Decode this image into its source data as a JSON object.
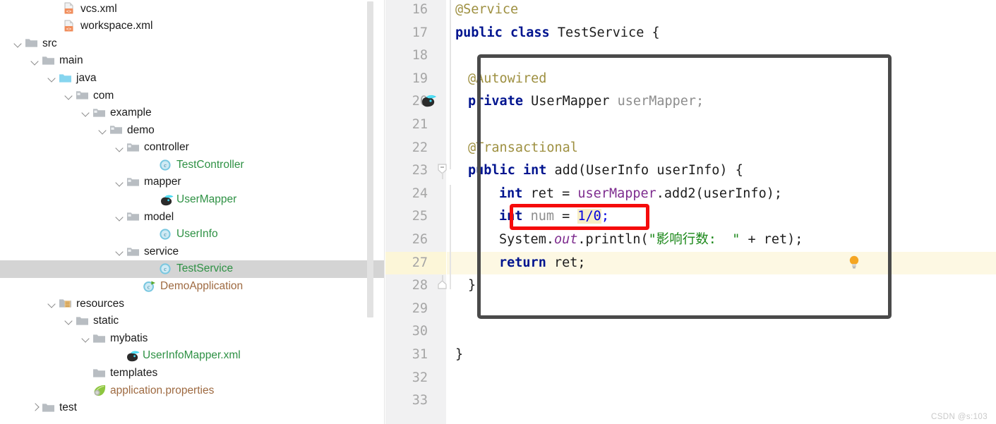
{
  "sidebar": {
    "name": "project-tree",
    "scrollbar": {
      "name": "vertical-scrollbar"
    },
    "items": [
      {
        "label": "vcs.xml",
        "indent": 72,
        "arrow": "none",
        "icon": "xml-file-icon",
        "color": "plain"
      },
      {
        "label": "workspace.xml",
        "indent": 72,
        "arrow": "none",
        "icon": "xml-file-icon",
        "color": "plain"
      },
      {
        "label": "src",
        "indent": 18,
        "arrow": "down",
        "icon": "folder-icon",
        "color": "plain"
      },
      {
        "label": "main",
        "indent": 42,
        "arrow": "down",
        "icon": "folder-icon",
        "color": "plain"
      },
      {
        "label": "java",
        "indent": 66,
        "arrow": "down",
        "icon": "source-folder-icon",
        "color": "plain"
      },
      {
        "label": "com",
        "indent": 90,
        "arrow": "down",
        "icon": "package-folder-icon",
        "color": "plain"
      },
      {
        "label": "example",
        "indent": 114,
        "arrow": "down",
        "icon": "package-folder-icon",
        "color": "plain"
      },
      {
        "label": "demo",
        "indent": 138,
        "arrow": "down",
        "icon": "package-folder-icon",
        "color": "plain"
      },
      {
        "label": "controller",
        "indent": 162,
        "arrow": "down",
        "icon": "package-folder-icon",
        "color": "plain"
      },
      {
        "label": "TestController",
        "indent": 208,
        "arrow": "none",
        "icon": "java-class-icon",
        "color": "green"
      },
      {
        "label": "mapper",
        "indent": 162,
        "arrow": "down",
        "icon": "package-folder-icon",
        "color": "plain"
      },
      {
        "label": "UserMapper",
        "indent": 208,
        "arrow": "none",
        "icon": "mybatis-icon",
        "color": "green"
      },
      {
        "label": "model",
        "indent": 162,
        "arrow": "down",
        "icon": "package-folder-icon",
        "color": "plain"
      },
      {
        "label": "UserInfo",
        "indent": 208,
        "arrow": "none",
        "icon": "java-class-icon",
        "color": "green"
      },
      {
        "label": "service",
        "indent": 162,
        "arrow": "down",
        "icon": "package-folder-icon",
        "color": "plain"
      },
      {
        "label": "TestService",
        "indent": 208,
        "arrow": "none",
        "icon": "java-class-icon",
        "color": "green",
        "selected": true
      },
      {
        "label": "DemoApplication",
        "indent": 185,
        "arrow": "none",
        "icon": "spring-boot-class-icon",
        "color": "brown"
      },
      {
        "label": "resources",
        "indent": 66,
        "arrow": "down",
        "icon": "resources-folder-icon",
        "color": "plain"
      },
      {
        "label": "static",
        "indent": 90,
        "arrow": "down",
        "icon": "folder-icon",
        "color": "plain"
      },
      {
        "label": "mybatis",
        "indent": 114,
        "arrow": "down",
        "icon": "folder-icon",
        "color": "plain"
      },
      {
        "label": "UserInfoMapper.xml",
        "indent": 160,
        "arrow": "none",
        "icon": "mybatis-icon",
        "color": "green"
      },
      {
        "label": "templates",
        "indent": 114,
        "arrow": "none",
        "icon": "folder-icon",
        "color": "plain"
      },
      {
        "label": "application.properties",
        "indent": 114,
        "arrow": "none",
        "icon": "spring-leaf-icon",
        "color": "brown"
      },
      {
        "label": "test",
        "indent": 42,
        "arrow": "right",
        "icon": "folder-icon",
        "color": "plain"
      }
    ]
  },
  "editor": {
    "name": "code-editor",
    "highlighted_line": 27,
    "caret_line": 27,
    "gutter_icons": {
      "line20": "mybatis-mapper-icon",
      "line27": "intention-bulb-icon",
      "line23": "fold-collapse-icon",
      "line28": "fold-end-icon"
    },
    "lines": [
      {
        "n": "16",
        "indent": 0
      },
      {
        "n": "17",
        "indent": 0
      },
      {
        "n": "18",
        "indent": 0
      },
      {
        "n": "19",
        "indent": 0
      },
      {
        "n": "20",
        "indent": 0
      },
      {
        "n": "21",
        "indent": 0
      },
      {
        "n": "22",
        "indent": 0
      },
      {
        "n": "23",
        "indent": 0
      },
      {
        "n": "24",
        "indent": 0
      },
      {
        "n": "25",
        "indent": 0
      },
      {
        "n": "26",
        "indent": 0
      },
      {
        "n": "27",
        "indent": 0
      },
      {
        "n": "28",
        "indent": 0
      },
      {
        "n": "29",
        "indent": 0
      },
      {
        "n": "30",
        "indent": 0
      },
      {
        "n": "31",
        "indent": 0
      },
      {
        "n": "32",
        "indent": 0
      },
      {
        "n": "33",
        "indent": 0
      }
    ],
    "source": {
      "l16": "@Service",
      "l17_k1": "public",
      "l17_k2": "class",
      "l17_name": "TestService",
      "l17_brace": "{",
      "l19": "@Autowired",
      "l20_k": "private",
      "l20_type": "UserMapper",
      "l20_field": "userMapper;",
      "l22": "@Transactional",
      "l23_k1": "public",
      "l23_k2": "int",
      "l23_sig": "add(UserInfo userInfo) {",
      "l24_k": "int",
      "l24_a": "ret = ",
      "l24_obj": "userMapper",
      "l24_b": ".add2(userInfo);",
      "l25_k": "int",
      "l25_var": "num",
      "l25_eq": "= ",
      "l25_num": "1/0",
      "l25_semi": ";",
      "l26_sys": "System.",
      "l26_out": "out",
      "l26_pr": ".println(",
      "l26_str": "\"影响行数:  \"",
      "l26_tail": " + ret);",
      "l27_k": "return",
      "l27_rest": " ret;",
      "l28_brace": "}",
      "l31_brace": "}"
    }
  },
  "annotations": {
    "dark_box": {
      "name": "method-highlight-box",
      "color": "#4a4a4a"
    },
    "red_box": {
      "name": "divide-by-zero-highlight-box",
      "color": "#f50b0b"
    }
  },
  "watermark": {
    "text": "CSDN @s:103"
  }
}
